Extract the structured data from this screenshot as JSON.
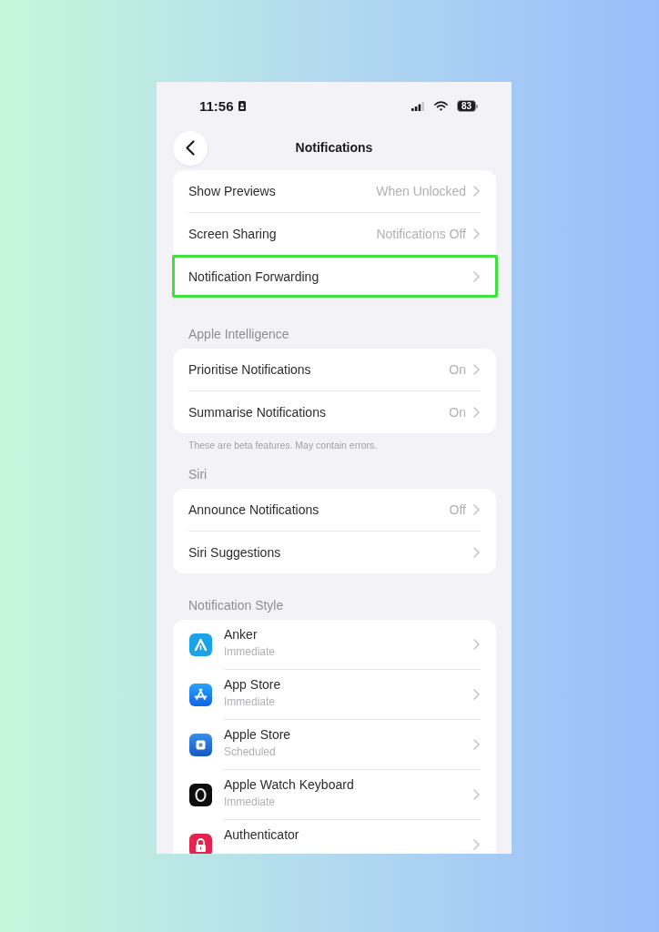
{
  "status_bar": {
    "time": "11:56",
    "battery": "83"
  },
  "nav_bar": {
    "title": "Notifications"
  },
  "sections": [
    {
      "rows": [
        {
          "kind": "setting",
          "label": "Show Previews",
          "value": "When Unlocked",
          "highlighted": false
        },
        {
          "kind": "setting",
          "label": "Screen Sharing",
          "value": "Notifications Off",
          "highlighted": false
        },
        {
          "kind": "setting",
          "label": "Notification Forwarding",
          "highlighted": true
        }
      ]
    },
    {
      "header": "Apple Intelligence",
      "rows": [
        {
          "kind": "setting",
          "label": "Prioritise Notifications",
          "value": "On",
          "highlighted": false
        },
        {
          "kind": "setting",
          "label": "Summarise Notifications",
          "value": "On",
          "highlighted": false
        }
      ],
      "footer": "These are beta features. May contain errors."
    },
    {
      "header": "Siri",
      "rows": [
        {
          "kind": "setting",
          "label": "Announce Notifications",
          "value": "Off",
          "highlighted": false
        },
        {
          "kind": "setting",
          "label": "Siri Suggestions",
          "highlighted": false
        }
      ]
    },
    {
      "header": "Notification Style",
      "rows": [
        {
          "kind": "app",
          "name": "Anker",
          "subtitle": "Immediate",
          "highlighted": false
        },
        {
          "kind": "app",
          "name": "App Store",
          "subtitle": "Immediate",
          "highlighted": false
        },
        {
          "kind": "app",
          "name": "Apple Store",
          "subtitle": "Scheduled",
          "highlighted": false
        },
        {
          "kind": "app",
          "name": "Apple Watch Keyboard",
          "subtitle": "Immediate",
          "highlighted": false
        },
        {
          "kind": "app",
          "name": "Authenticator",
          "highlighted": false
        }
      ]
    }
  ]
}
